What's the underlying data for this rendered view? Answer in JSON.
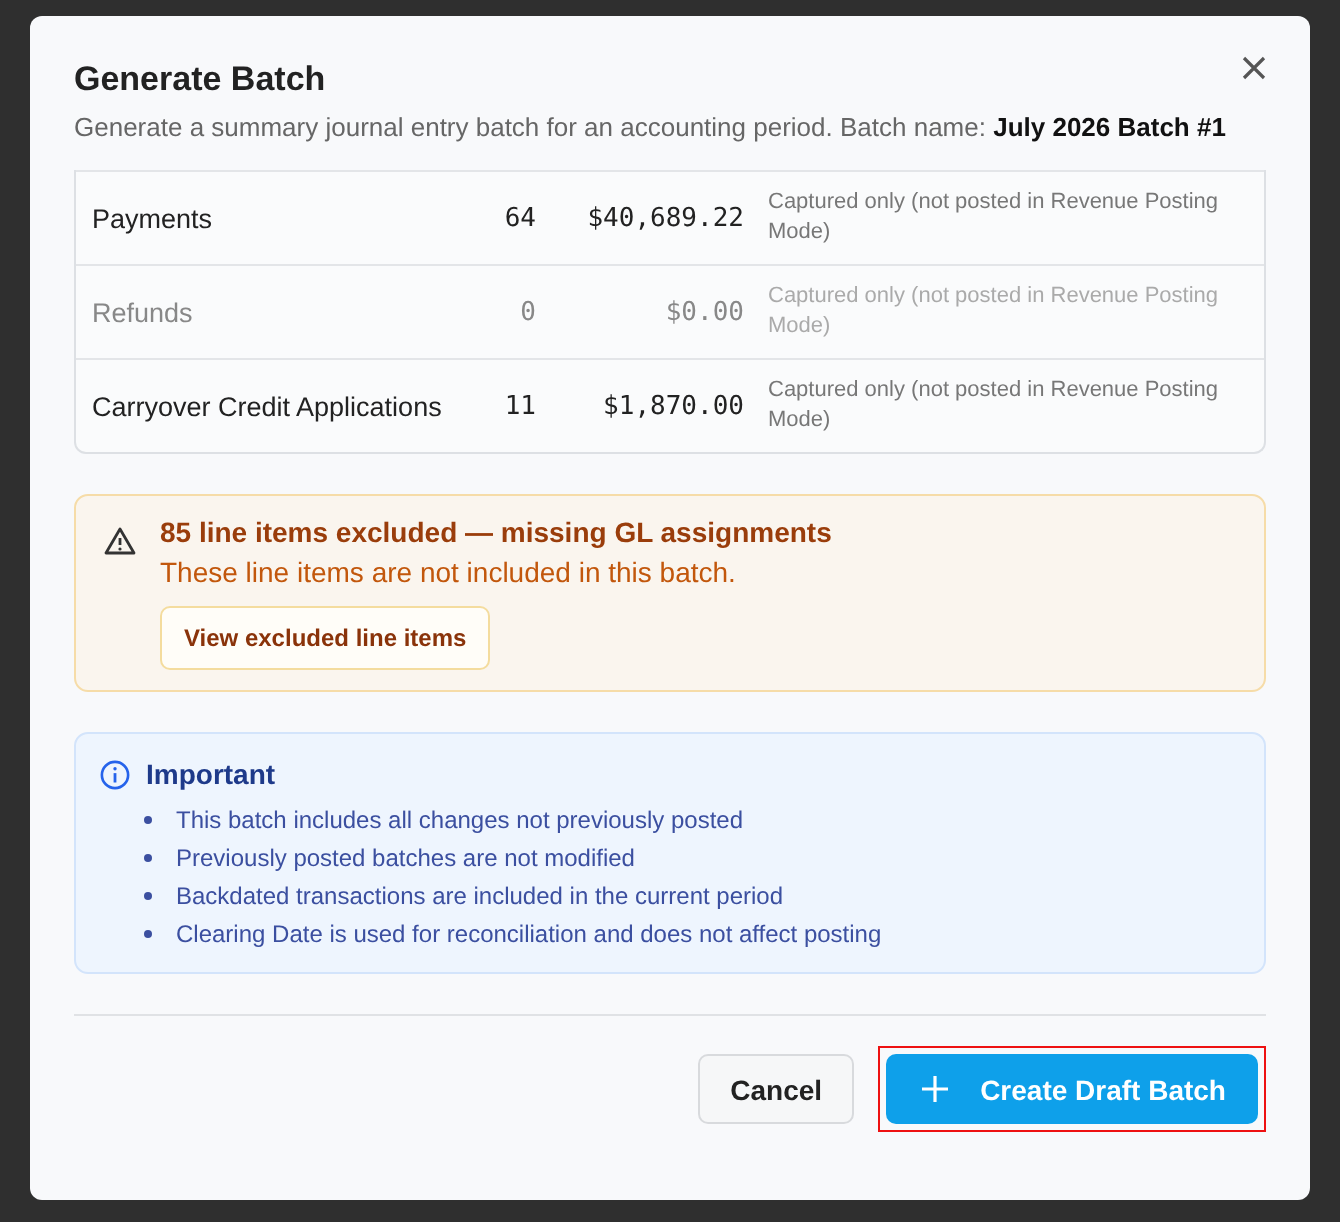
{
  "dialog": {
    "title": "Generate Batch",
    "subtitle": "Generate a summary journal entry batch for an accounting period. Batch name: **July 2026 Batch #1**"
  },
  "rows": [
    {
      "name": "Payments",
      "count": "64",
      "amount": "$40,689.22",
      "note": "Captured only (not posted in Revenue Posting Mode)",
      "muted": false
    },
    {
      "name": "Refunds",
      "count": "0",
      "amount": "$0.00",
      "note": "Captured only (not posted in Revenue Posting Mode)",
      "muted": true
    },
    {
      "name": "Carryover Credit Applications",
      "count": "11",
      "amount": "$1,870.00",
      "note": "Captured only (not posted in Revenue Posting Mode)",
      "muted": false
    }
  ],
  "warning": {
    "title": "85 line items excluded — missing GL assignments",
    "message": "These line items are not included in this batch.",
    "button": "View excluded line items"
  },
  "info": {
    "title": "Important",
    "items": [
      "This batch includes all changes not previously posted",
      "Previously posted batches are not modified",
      "Backdated transactions are included in the current period",
      "Clearing Date is used for reconciliation and does not affect posting"
    ]
  },
  "buttons": [
    {
      "label": "Cancel",
      "kind": "secondary",
      "highlighted": false
    },
    {
      "label": "Create Draft Batch",
      "kind": "primary",
      "highlighted": true
    }
  ]
}
